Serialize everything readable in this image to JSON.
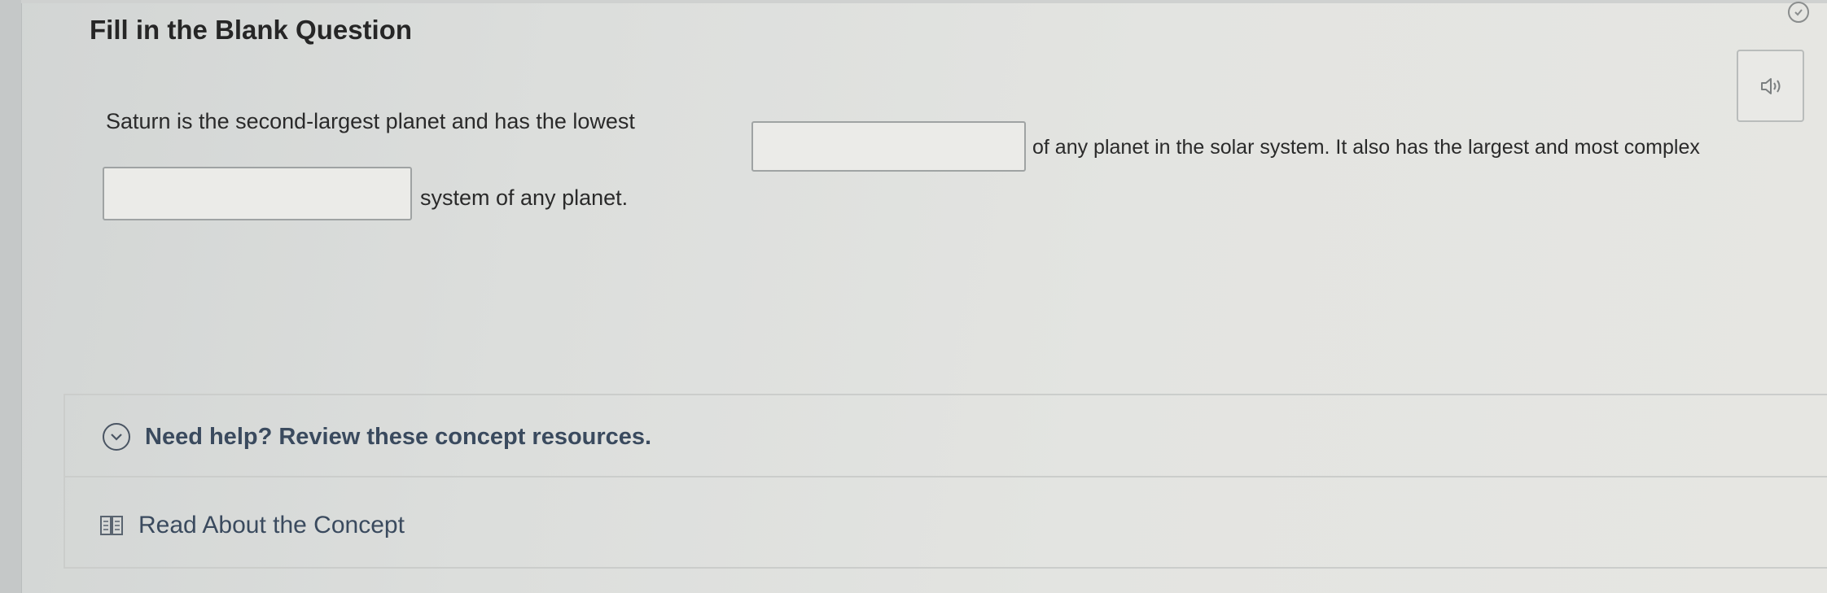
{
  "question": {
    "title": "Fill in the Blank Question",
    "text_part_1": "Saturn is the second-largest planet and has the lowest",
    "text_part_2": "of any planet in the solar system. It also has the largest and most complex",
    "text_part_3": "system of any planet.",
    "blank_1_value": "",
    "blank_2_value": ""
  },
  "toolbar": {
    "audio_icon": "speaker-icon",
    "status_icon": "check-circle-icon"
  },
  "help": {
    "toggle_label": "Need help? Review these concept resources.",
    "toggle_icon": "chevron-down-circle-icon",
    "resources": [
      {
        "label": "Read About the Concept",
        "icon": "book-icon"
      }
    ]
  },
  "colors": {
    "help_text": "#3a4a5e",
    "body_text": "#262626",
    "input_border": "#9fa3a3"
  }
}
